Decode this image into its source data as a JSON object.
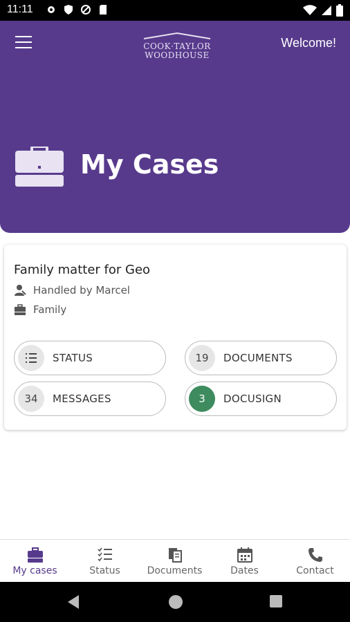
{
  "status_bar": {
    "time": "11:11"
  },
  "header": {
    "logo_line1": "COOK·TAYLOR",
    "logo_line2": "WOODHOUSE",
    "welcome": "Welcome!",
    "page_title": "My Cases",
    "accent_color": "#573a8c"
  },
  "case": {
    "title": "Family matter for Geo",
    "handled_by": "Handled by Marcel",
    "category": "Family",
    "buttons": {
      "status": {
        "label": "STATUS"
      },
      "documents": {
        "count": "19",
        "label": "DOCUMENTS"
      },
      "messages": {
        "count": "34",
        "label": "MESSAGES"
      },
      "docusign": {
        "count": "3",
        "label": "DOCUSIGN",
        "badge_color": "#3d8b5e"
      }
    }
  },
  "bottom_nav": {
    "items": [
      {
        "label": "My cases",
        "icon": "briefcase-icon",
        "active": true
      },
      {
        "label": "Status",
        "icon": "checklist-icon",
        "active": false
      },
      {
        "label": "Documents",
        "icon": "documents-icon",
        "active": false
      },
      {
        "label": "Dates",
        "icon": "calendar-icon",
        "active": false
      },
      {
        "label": "Contact",
        "icon": "phone-icon",
        "active": false
      }
    ]
  }
}
